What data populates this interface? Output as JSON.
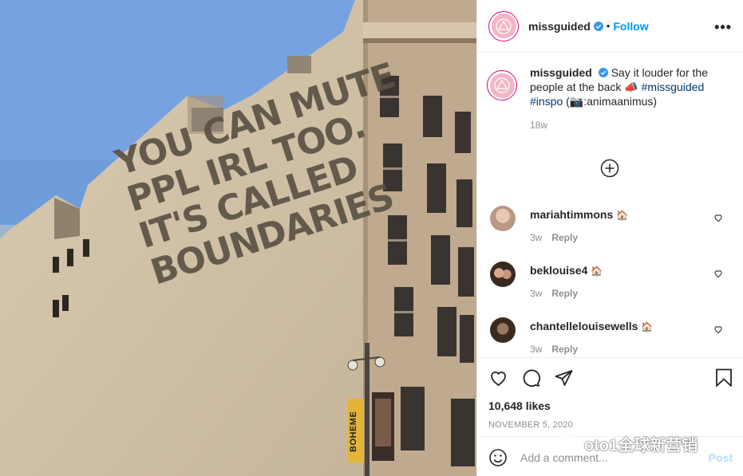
{
  "colors": {
    "accent": "#0095f6",
    "text": "#262626",
    "muted": "#8e8e8e",
    "hashtag": "#00376b",
    "post_disabled": "#b2dffc",
    "sky": "#6f9ddc",
    "wall": "#d3c3a9"
  },
  "photo": {
    "wall_text": [
      "YOU CAN MUTE",
      "PPL IRL TOO.",
      "IT'S CALLED",
      "BOUNDARIES"
    ],
    "banner_text": "BOHEME"
  },
  "header": {
    "username": "missguided",
    "separator": "•",
    "follow_label": "Follow",
    "more_icon": "more-horizontal-icon",
    "more_label": "•••"
  },
  "caption": {
    "username": "missguided",
    "text": "Say it louder for the people at the back 📣",
    "hashtags": [
      "#missguided",
      "#inspo"
    ],
    "credit": "(📷:animaanimus)",
    "time": "18w",
    "load_more_icon": "plus-circle-icon"
  },
  "comments": [
    {
      "username": "mariahtimmons",
      "badge": "🏠",
      "time": "3w",
      "reply": "Reply"
    },
    {
      "username": "beklouise4",
      "badge": "🏠",
      "time": "3w",
      "reply": "Reply"
    },
    {
      "username": "chantellelouisewells",
      "badge": "🏠",
      "time": "3w",
      "reply": "Reply"
    }
  ],
  "actions": {
    "icons": [
      "heart-icon",
      "comment-icon",
      "share-icon",
      "bookmark-icon"
    ],
    "likes": "10,648 likes",
    "date": "NOVEMBER 5, 2020"
  },
  "add_comment": {
    "placeholder": "Add a comment...",
    "post_label": "Post",
    "emoji_icon": "emoji-icon"
  },
  "watermark": {
    "text": "oto1全球新营销"
  }
}
